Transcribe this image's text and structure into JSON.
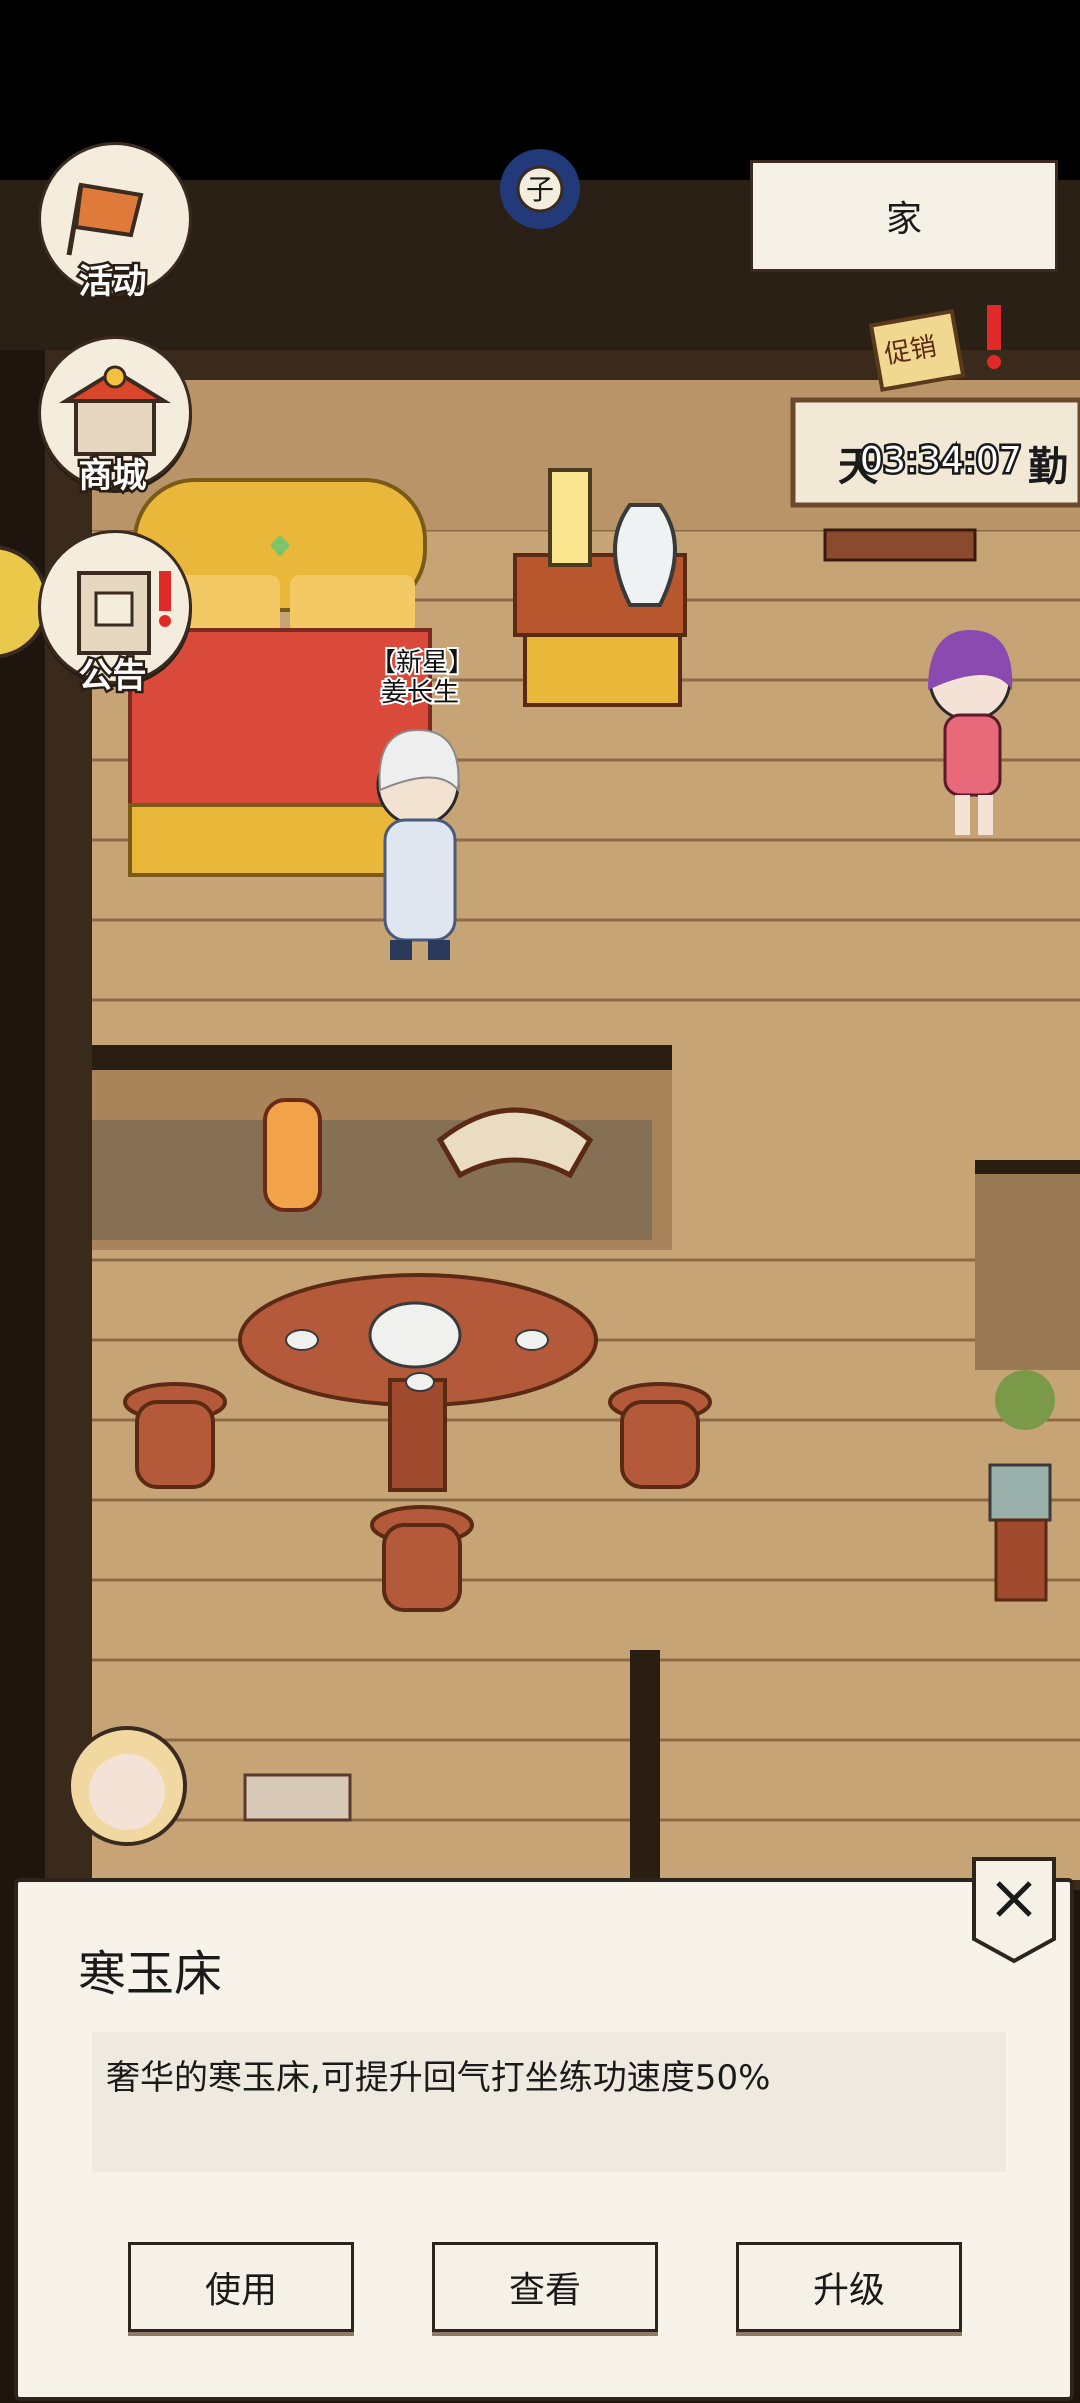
{
  "sidebar": {
    "activities": "活动",
    "shop": "商城",
    "notice": "公告"
  },
  "top": {
    "location": "家",
    "clock_char": "子"
  },
  "promo": {
    "timer": "03:34:07",
    "banner_left": "天",
    "banner_right": "勤",
    "badge": "促销"
  },
  "character": {
    "tag": "【新星】",
    "name": "姜长生"
  },
  "dialog": {
    "title": "寒玉床",
    "description": "奢华的寒玉床,可提升回气打坐练功速度50%",
    "use": "使用",
    "view": "查看",
    "upgrade": "升级"
  },
  "colors": {
    "floor": "#c9a77a",
    "wall": "#8a6a48",
    "dialog_bg": "#f7f3ea",
    "bed_red": "#d94a3a",
    "gold": "#e9b83a"
  }
}
